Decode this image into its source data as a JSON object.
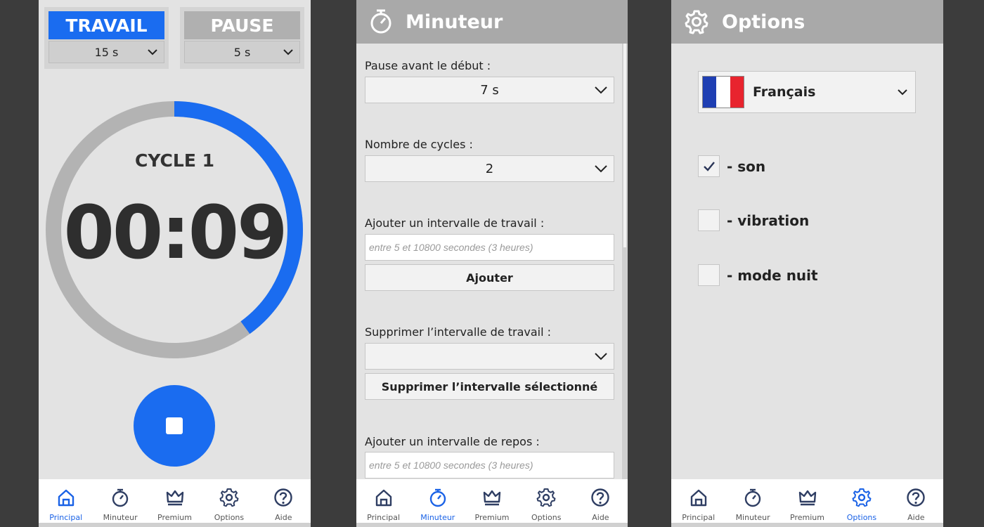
{
  "colors": {
    "accent": "#1a6cf0",
    "nav_active": "#1a62e6",
    "header": "#a9a9a9",
    "ring_track": "#b3b3b3",
    "ring_progress": "#1a6cf0"
  },
  "nav": [
    {
      "label": "Principal",
      "icon": "home-icon"
    },
    {
      "label": "Minuteur",
      "icon": "stopwatch-icon"
    },
    {
      "label": "Premium",
      "icon": "crown-icon"
    },
    {
      "label": "Options",
      "icon": "gear-icon"
    },
    {
      "label": "Aide",
      "icon": "help-icon"
    }
  ],
  "main": {
    "work": {
      "title": "TRAVAIL",
      "value": "15 s"
    },
    "pause": {
      "title": "PAUSE",
      "value": "5 s"
    },
    "cycle": "CYCLE 1",
    "time": "00:09",
    "progress": 0.4,
    "active_nav": "Principal"
  },
  "timer": {
    "title": "Minuteur",
    "pause_before_label": "Pause avant le début :",
    "pause_before_value": "7 s",
    "cycles_label": "Nombre de cycles :",
    "cycles_value": "2",
    "add_work_label": "Ajouter un intervalle de travail :",
    "add_work_placeholder": "entre 5 et 10800 secondes (3 heures)",
    "add_button": "Ajouter",
    "remove_work_label": "Supprimer l’intervalle de travail :",
    "remove_work_value": "",
    "remove_button": "Supprimer l’intervalle sélectionné",
    "add_rest_label": "Ajouter un intervalle de repos :",
    "add_rest_placeholder": "entre 5 et 10800 secondes (3 heures)",
    "active_nav": "Minuteur"
  },
  "options": {
    "title": "Options",
    "language": "Français",
    "flag_colors": [
      "#1f3fb3",
      "#ffffff",
      "#e8242e"
    ],
    "items": [
      {
        "label": "- son",
        "checked": true
      },
      {
        "label": "- vibration",
        "checked": false
      },
      {
        "label": "- mode nuit",
        "checked": false
      }
    ],
    "active_nav": "Options"
  }
}
